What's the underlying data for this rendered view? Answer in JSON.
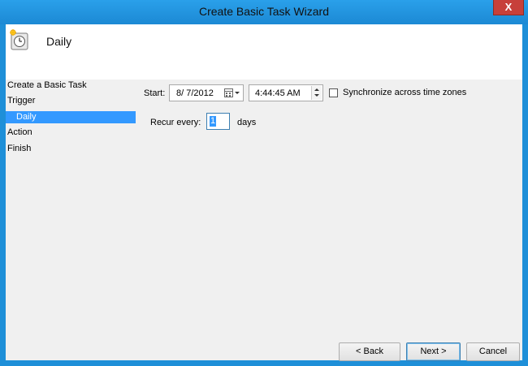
{
  "window": {
    "title": "Create Basic Task Wizard",
    "close_label": "X"
  },
  "header": {
    "title": "Daily",
    "icon": "clock-icon"
  },
  "nav": {
    "items": [
      {
        "label": "Create a Basic Task"
      },
      {
        "label": "Trigger"
      },
      {
        "label": "Daily",
        "active": true
      },
      {
        "label": "Action"
      },
      {
        "label": "Finish"
      }
    ]
  },
  "form": {
    "start_label": "Start:",
    "start_date": "8/ 7/2012",
    "start_time": "4:44:45 AM",
    "sync_label": "Synchronize across time zones",
    "sync_checked": false,
    "recur_label": "Recur every:",
    "recur_value": "1",
    "recur_unit": "days"
  },
  "buttons": {
    "back": "< Back",
    "next": "Next >",
    "cancel": "Cancel"
  }
}
